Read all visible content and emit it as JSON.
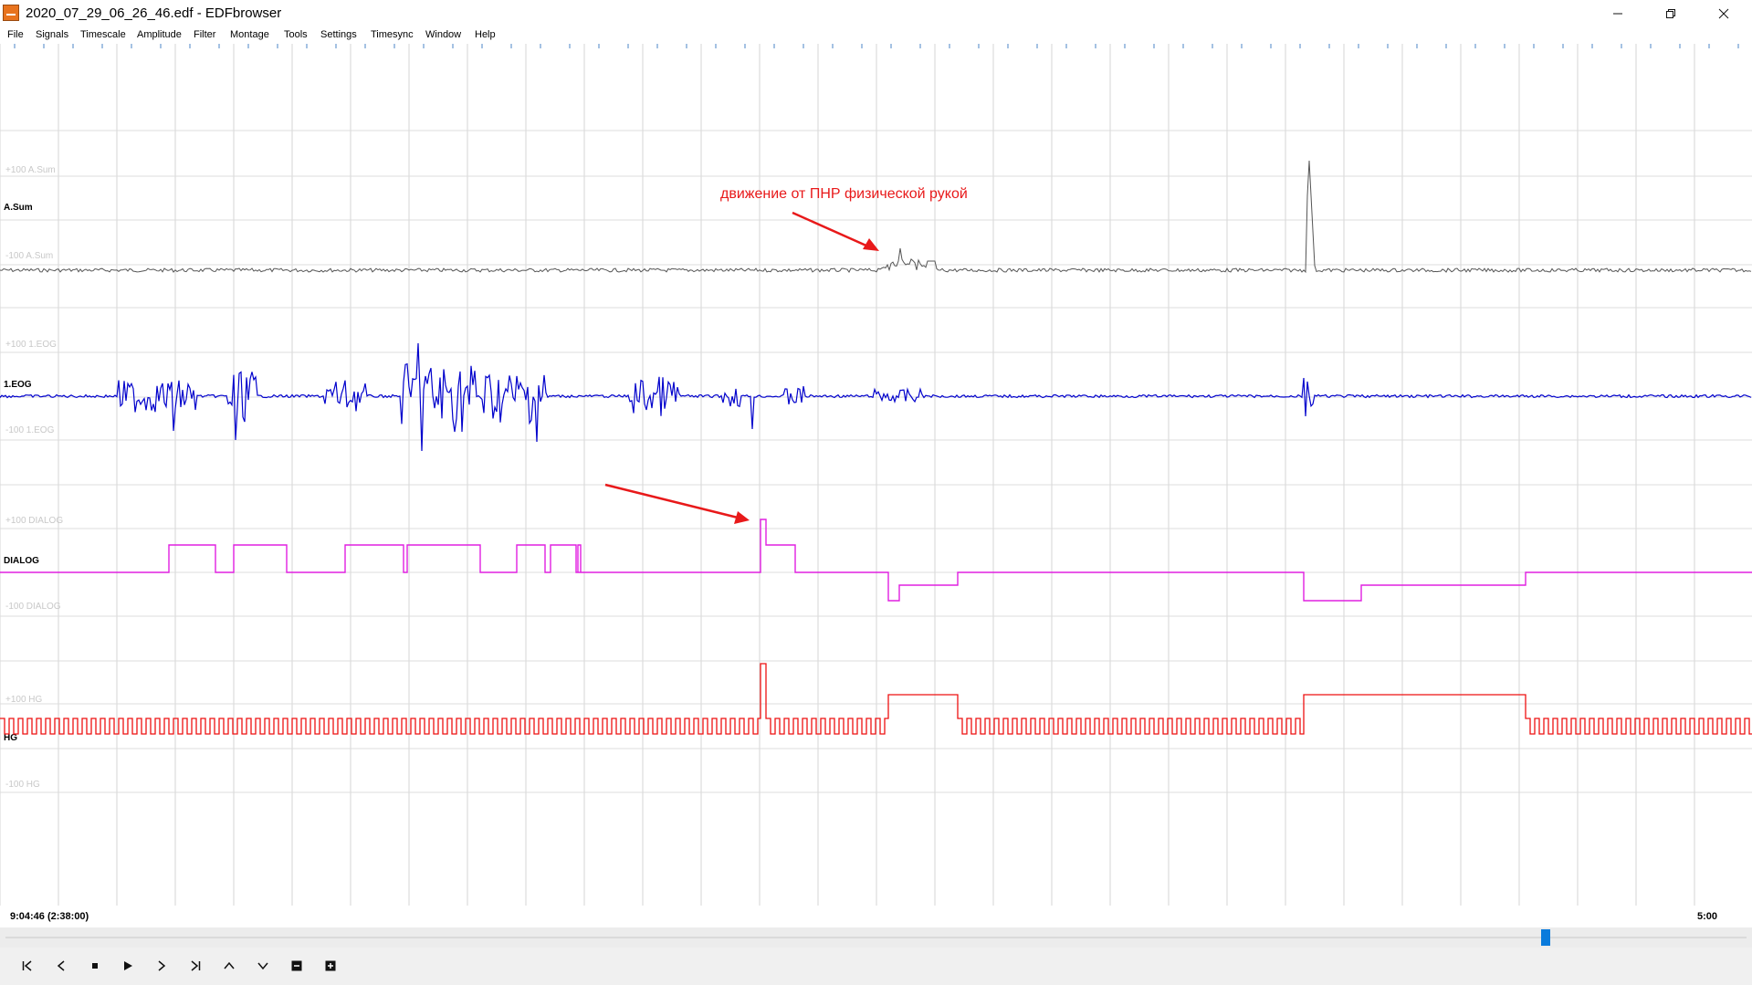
{
  "window": {
    "title": "2020_07_29_06_26_46.edf - EDFbrowser",
    "controls": [
      "minimize-icon",
      "restore-icon",
      "close-icon"
    ]
  },
  "menu": [
    "File",
    "Signals",
    "Timescale",
    "Amplitude",
    "Filter",
    "Montage",
    "Tools",
    "Settings",
    "Timesync",
    "Window",
    "Help"
  ],
  "signals": [
    {
      "name": "A.Sum",
      "upper": "+100 A.Sum",
      "lower": "-100 A.Sum",
      "color": "#555555"
    },
    {
      "name": "1.EOG",
      "upper": "+100 1.EOG",
      "lower": "-100 1.EOG",
      "color": "#0000cc"
    },
    {
      "name": "DIALOG",
      "upper": "+100 DIALOG",
      "lower": "-100 DIALOG",
      "color": "#e020e0"
    },
    {
      "name": "HG",
      "upper": "+100 HG",
      "lower": "-100 HG",
      "color": "#ee1111"
    }
  ],
  "annotation": {
    "text": "движение от ПНР физической рукой",
    "color": "#e8191a"
  },
  "status": {
    "start_time": "9:04:46 (2:38:00)",
    "end_time": "5:00"
  },
  "scroll": {
    "position": 0.884
  },
  "toolbar": [
    "first-page-icon",
    "prev-page-icon",
    "stop-icon",
    "play-icon",
    "next-page-icon",
    "last-page-icon",
    "amplitude-up-icon",
    "amplitude-down-icon",
    "zoom-out-icon",
    "zoom-in-icon"
  ]
}
